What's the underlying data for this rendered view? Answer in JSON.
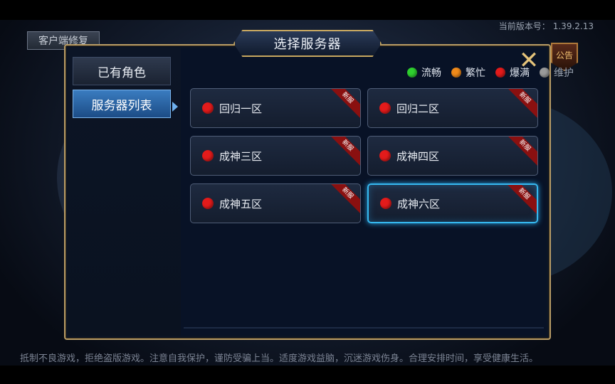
{
  "top": {
    "repair_button": "客户端修复",
    "version_label": "当前版本号：",
    "version_value": "1.39.2.13",
    "notice_button": "公告"
  },
  "dialog": {
    "title": "选择服务器",
    "close_icon": "close-icon"
  },
  "sidebar": {
    "items": [
      {
        "label": "已有角色",
        "active": false
      },
      {
        "label": "服务器列表",
        "active": true
      }
    ]
  },
  "legend": [
    {
      "label": "流畅",
      "color": "#2fd02f"
    },
    {
      "label": "繁忙",
      "color": "#f08a1a"
    },
    {
      "label": "爆满",
      "color": "#e31b1b"
    },
    {
      "label": "维护",
      "color": "#9a9a9a"
    }
  ],
  "servers": [
    {
      "name": "回归一区",
      "badge": "新服",
      "status_color": "#e31b1b",
      "selected": false
    },
    {
      "name": "回归二区",
      "badge": "新服",
      "status_color": "#e31b1b",
      "selected": false
    },
    {
      "name": "成神三区",
      "badge": "新服",
      "status_color": "#e31b1b",
      "selected": false
    },
    {
      "name": "成神四区",
      "badge": "新服",
      "status_color": "#e31b1b",
      "selected": false
    },
    {
      "name": "成神五区",
      "badge": "新服",
      "status_color": "#e31b1b",
      "selected": false
    },
    {
      "name": "成神六区",
      "badge": "新服",
      "status_color": "#e31b1b",
      "selected": true
    }
  ],
  "footer": {
    "notice": "抵制不良游戏，拒绝盗版游戏。注意自我保护，谨防受骗上当。适度游戏益脑，沉迷游戏伤身。合理安排时间，享受健康生活。"
  }
}
